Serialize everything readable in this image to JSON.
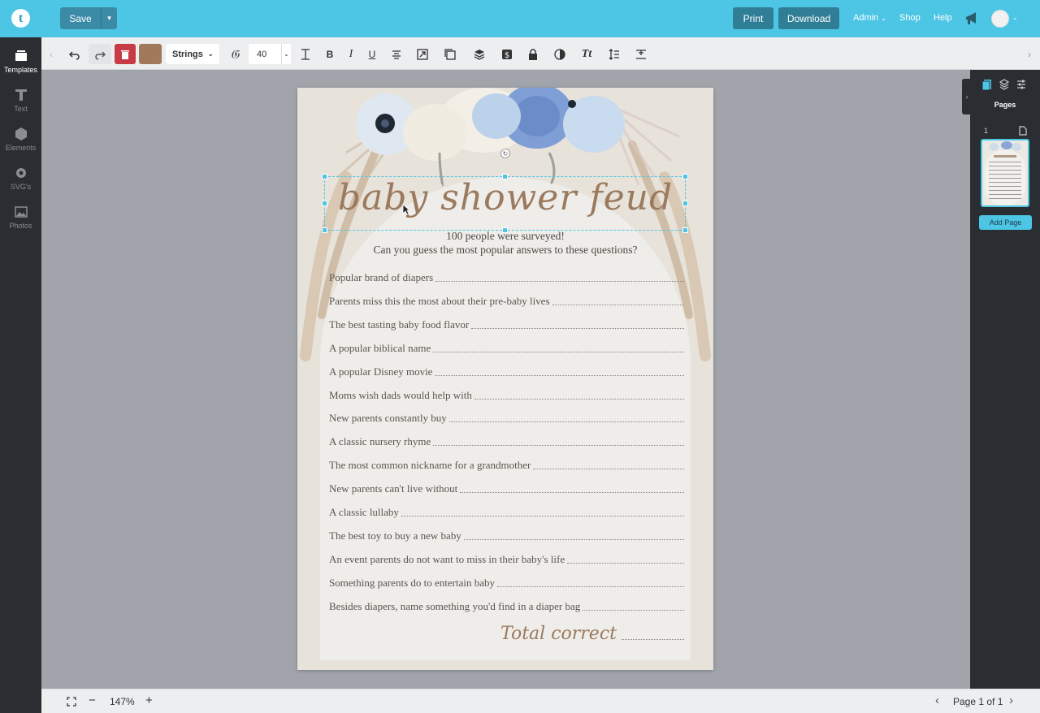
{
  "topbar": {
    "save_label": "Save",
    "print_label": "Print",
    "download_label": "Download",
    "admin_label": "Admin",
    "shop_label": "Shop",
    "help_label": "Help",
    "logo_letter": "t"
  },
  "sidebar": {
    "items": [
      {
        "label": "Templates",
        "icon": "templates-icon"
      },
      {
        "label": "Text",
        "icon": "text-icon"
      },
      {
        "label": "Elements",
        "icon": "elements-icon"
      },
      {
        "label": "SVG's",
        "icon": "svg-icon"
      },
      {
        "label": "Photos",
        "icon": "photos-icon"
      }
    ]
  },
  "toolbar": {
    "font_name": "Strings",
    "font_size": "40",
    "text_color": "#a07a5a"
  },
  "document": {
    "title": "baby shower feud",
    "subtitle_line1": "100 people were surveyed!",
    "subtitle_line2": "Can you guess the most popular answers to these questions?",
    "questions": [
      "Popular brand of diapers",
      "Parents miss this the most about their pre-baby lives",
      "The best tasting baby food flavor",
      "A popular biblical name",
      "A popular Disney movie",
      "Moms wish dads would help with",
      "New parents constantly buy",
      "A classic nursery rhyme",
      "The most common nickname for a grandmother",
      "New parents can't live without",
      "A classic lullaby",
      "The best toy to buy a new baby",
      "An event parents do not want to miss in their baby's life",
      "Something parents do to entertain baby",
      "Besides diapers, name something you'd find in a diaper bag"
    ],
    "total_label": "Total correct"
  },
  "rightpanel": {
    "title": "Pages",
    "page_number": "1",
    "add_page_label": "Add Page"
  },
  "bottombar": {
    "zoom": "147%",
    "page_indicator": "Page 1 of 1"
  },
  "colors": {
    "accent": "#4cc6e4",
    "button_dark": "#2f7e96",
    "delete": "#c63b45",
    "title_brown": "#9b7a5e"
  }
}
